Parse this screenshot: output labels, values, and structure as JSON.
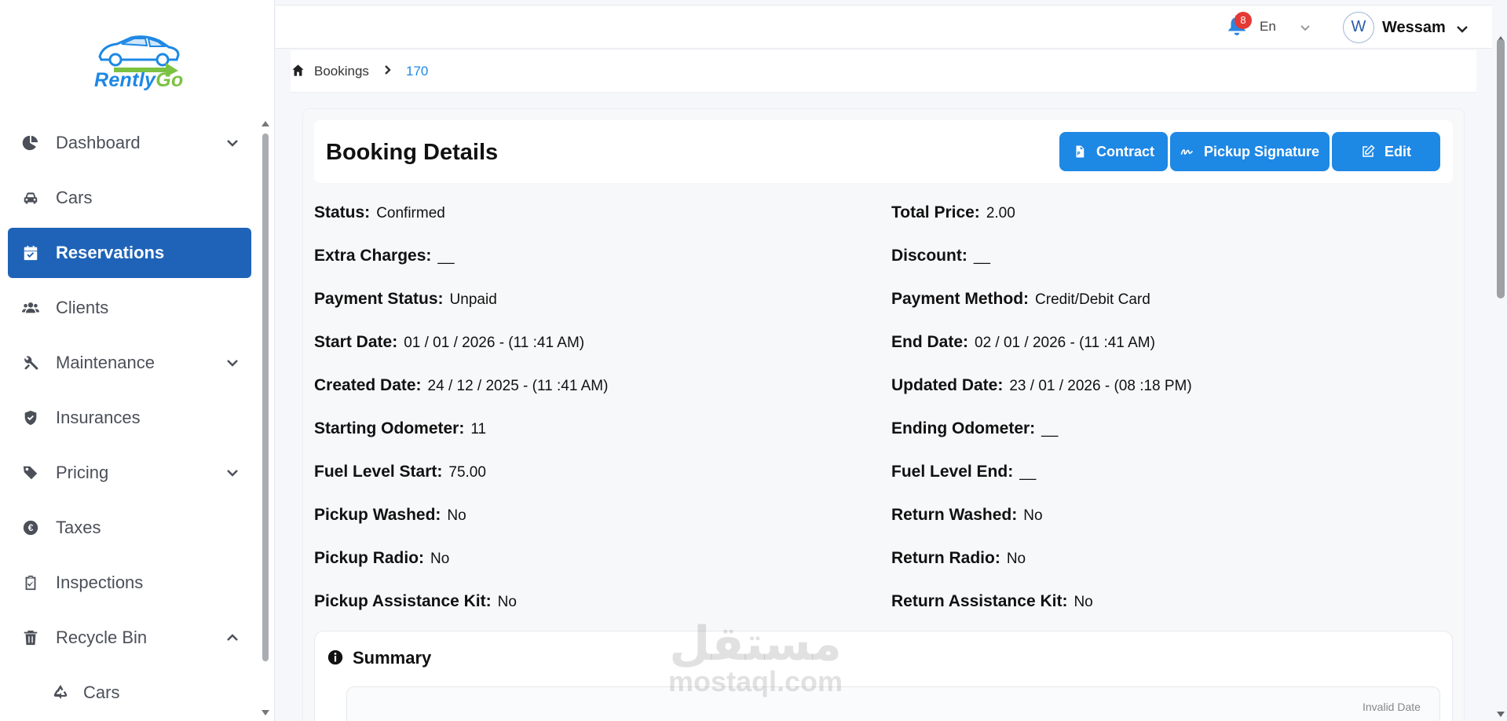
{
  "brand": {
    "name_part1": "Rently",
    "name_part2": "Go"
  },
  "sidebar": {
    "items": [
      {
        "label": "Dashboard",
        "icon": "pie-chart-icon",
        "has_chevron": true
      },
      {
        "label": "Cars",
        "icon": "car-icon",
        "has_chevron": false
      },
      {
        "label": "Reservations",
        "icon": "calendar-check-icon",
        "has_chevron": false,
        "active": true
      },
      {
        "label": "Clients",
        "icon": "users-icon",
        "has_chevron": false
      },
      {
        "label": "Maintenance",
        "icon": "tools-icon",
        "has_chevron": true
      },
      {
        "label": "Insurances",
        "icon": "shield-icon",
        "has_chevron": false
      },
      {
        "label": "Pricing",
        "icon": "tags-icon",
        "has_chevron": true
      },
      {
        "label": "Taxes",
        "icon": "euro-icon",
        "has_chevron": false
      },
      {
        "label": "Inspections",
        "icon": "clipboard-check-icon",
        "has_chevron": false
      },
      {
        "label": "Recycle Bin",
        "icon": "trash-icon",
        "has_chevron": true,
        "expanded": true
      }
    ],
    "sub_items": [
      {
        "label": "Cars",
        "icon": "recycle-icon"
      }
    ]
  },
  "header": {
    "notification_count": "8",
    "language": "En",
    "user_initial": "W",
    "user_name": "Wessam"
  },
  "breadcrumb": {
    "root": "Bookings",
    "current": "170"
  },
  "page": {
    "title": "Booking Details",
    "buttons": {
      "contract": "Contract",
      "pickup_signature": "Pickup Signature",
      "edit": "Edit"
    }
  },
  "details": {
    "left": [
      {
        "key": "Status:",
        "value": "Confirmed"
      },
      {
        "key": "Extra Charges:",
        "value": "__"
      },
      {
        "key": "Payment Status:",
        "value": "Unpaid"
      },
      {
        "key": "Start Date:",
        "value": "01 / 01 / 2026 - (11 :41 AM)"
      },
      {
        "key": "Created Date:",
        "value": "24 / 12 / 2025 - (11 :41 AM)"
      },
      {
        "key": "Starting Odometer:",
        "value": "11"
      },
      {
        "key": "Fuel Level Start:",
        "value": "75.00"
      },
      {
        "key": "Pickup Washed:",
        "value": "No"
      },
      {
        "key": "Pickup Radio:",
        "value": "No"
      },
      {
        "key": "Pickup Assistance Kit:",
        "value": "No"
      }
    ],
    "right": [
      {
        "key": "Total Price:",
        "value": "2.00"
      },
      {
        "key": "Discount:",
        "value": "__"
      },
      {
        "key": "Payment Method:",
        "value": "Credit/Debit Card"
      },
      {
        "key": "End Date:",
        "value": "02 / 01 / 2026 - (11 :41 AM)"
      },
      {
        "key": "Updated Date:",
        "value": "23 / 01 / 2026 - (08 :18 PM)"
      },
      {
        "key": "Ending Odometer:",
        "value": "__"
      },
      {
        "key": "Fuel Level End:",
        "value": "__"
      },
      {
        "key": "Return Washed:",
        "value": "No"
      },
      {
        "key": "Return Radio:",
        "value": "No"
      },
      {
        "key": "Return Assistance Kit:",
        "value": "No"
      }
    ]
  },
  "summary": {
    "title": "Summary",
    "date_text": "Invalid Date"
  },
  "watermark": {
    "arabic": "مستقل",
    "latin": "mostaql.com"
  },
  "colors": {
    "primary": "#1e88e5",
    "active_nav": "#1e63b8",
    "badge": "#e53935",
    "brand_green": "#7cc242"
  }
}
